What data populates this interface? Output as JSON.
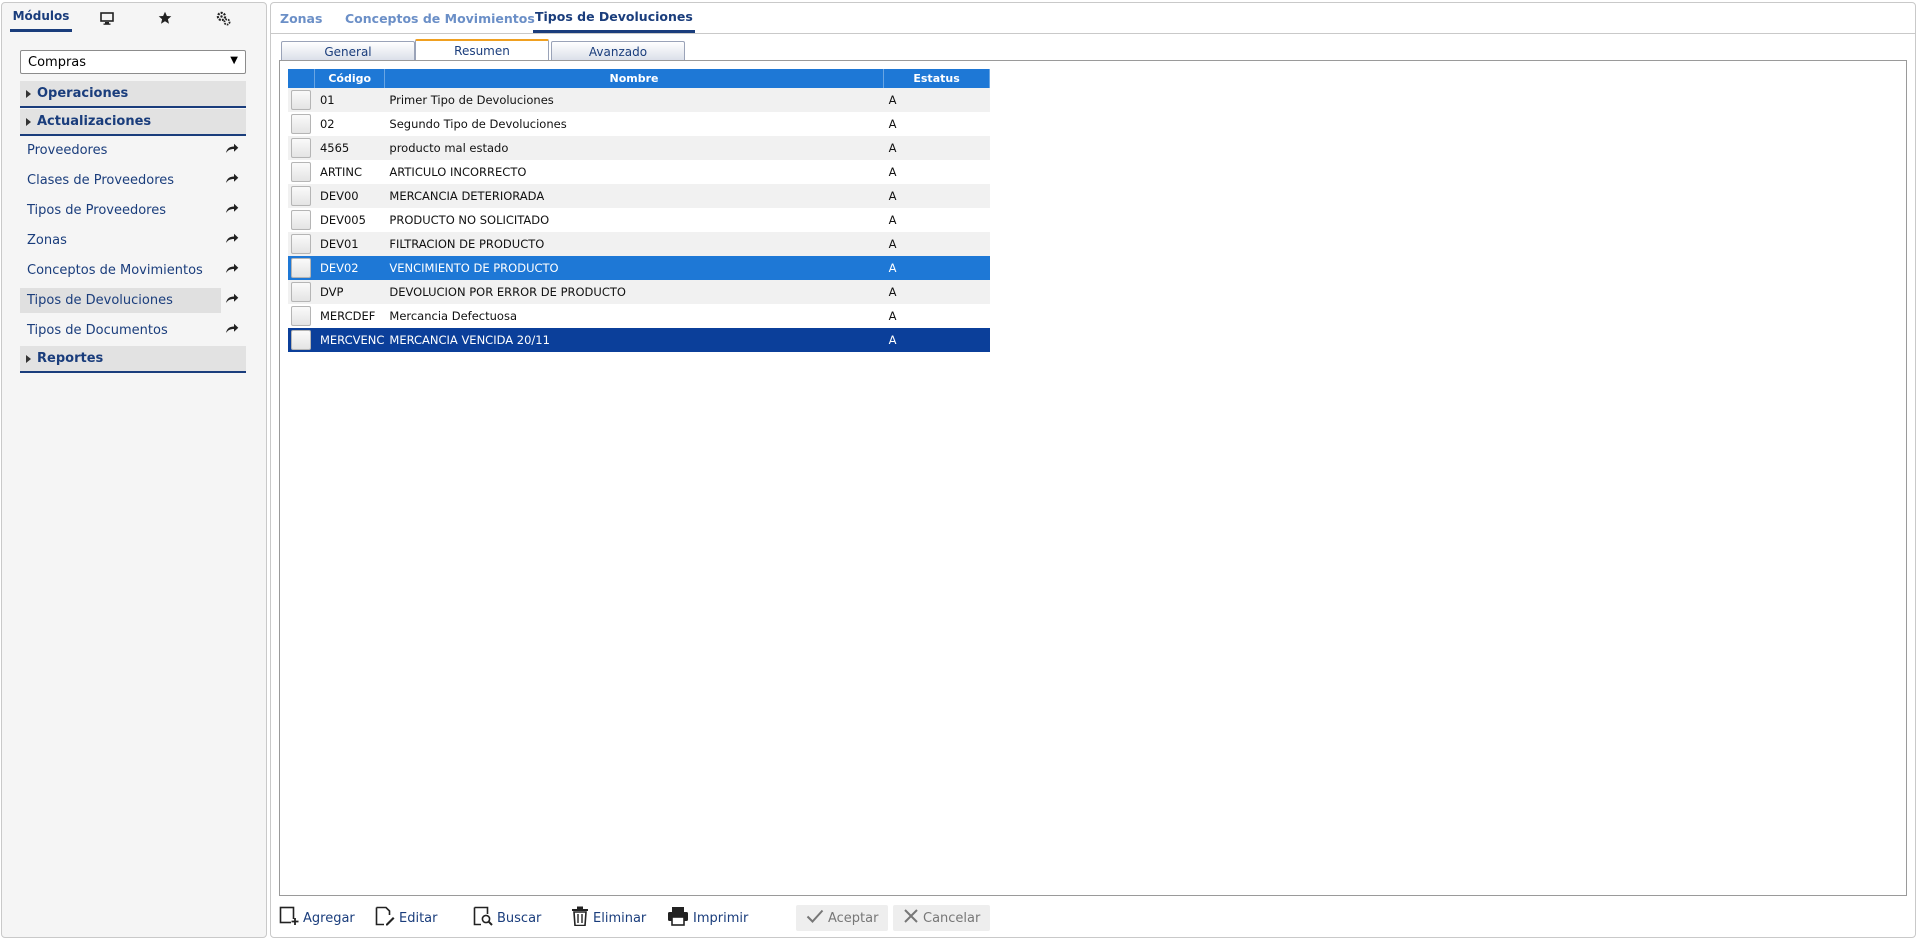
{
  "sidebar": {
    "tabs": [
      {
        "label": "Módulos",
        "icon": ""
      },
      {
        "label": "",
        "icon": "monitor-icon"
      },
      {
        "label": "",
        "icon": "star-icon"
      },
      {
        "label": "",
        "icon": "gears-icon"
      }
    ],
    "module_select": "Compras",
    "sections": {
      "operaciones": "Operaciones",
      "actualizaciones": "Actualizaciones",
      "reportes": "Reportes"
    },
    "items": [
      "Proveedores",
      "Clases de Proveedores",
      "Tipos de Proveedores",
      "Zonas",
      "Conceptos de Movimientos",
      "Tipos de Devoluciones",
      "Tipos de Documentos"
    ],
    "active_item": "Tipos de Devoluciones"
  },
  "top_tabs": [
    "Zonas",
    "Conceptos de Movimientos",
    "Tipos de Devoluciones"
  ],
  "sub_tabs": [
    "General",
    "Resumen",
    "Avanzado"
  ],
  "grid": {
    "headers": {
      "codigo": "Código",
      "nombre": "Nombre",
      "estatus": "Estatus"
    },
    "rows": [
      {
        "codigo": "01",
        "nombre": "Primer Tipo de Devoluciones",
        "estatus": "A"
      },
      {
        "codigo": "02",
        "nombre": "Segundo Tipo de Devoluciones",
        "estatus": "A"
      },
      {
        "codigo": "4565",
        "nombre": "producto mal estado",
        "estatus": "A"
      },
      {
        "codigo": "ARTINC",
        "nombre": "ARTICULO INCORRECTO",
        "estatus": "A"
      },
      {
        "codigo": "DEV00",
        "nombre": "MERCANCIA DETERIORADA",
        "estatus": "A"
      },
      {
        "codigo": "DEV005",
        "nombre": "PRODUCTO NO SOLICITADO",
        "estatus": "A"
      },
      {
        "codigo": "DEV01",
        "nombre": "FILTRACION DE PRODUCTO",
        "estatus": "A"
      },
      {
        "codigo": "DEV02",
        "nombre": "VENCIMIENTO DE PRODUCTO",
        "estatus": "A"
      },
      {
        "codigo": "DVP",
        "nombre": "DEVOLUCION POR ERROR DE PRODUCTO",
        "estatus": "A"
      },
      {
        "codigo": "MERCDEF",
        "nombre": "Mercancia Defectuosa",
        "estatus": "A"
      },
      {
        "codigo": "MERCVENC",
        "nombre": "MERCANCIA VENCIDA 20/11",
        "estatus": "A"
      }
    ]
  },
  "toolbar": {
    "agregar": "Agregar",
    "editar": "Editar",
    "buscar": "Buscar",
    "eliminar": "Eliminar",
    "imprimir": "Imprimir",
    "aceptar": "Aceptar",
    "cancelar": "Cancelar"
  },
  "colors": {
    "accent": "#1a3d7c",
    "header_blue": "#1e78d6",
    "selected_dark": "#0b3f9a",
    "active_tab_marker": "#f0a020"
  }
}
